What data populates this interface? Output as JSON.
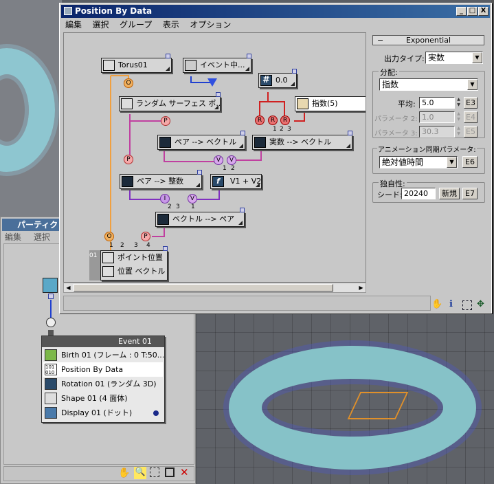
{
  "dialog": {
    "title": "Position By Data",
    "menu": [
      "編集",
      "選択",
      "グループ",
      "表示",
      "オプション"
    ],
    "window_buttons": [
      "_",
      "□",
      "X"
    ]
  },
  "nodes": {
    "torus": "Torus01",
    "event": "イベント中...",
    "float": "0.0",
    "exp": "指数(5)",
    "rsurf": "ランダム サーフェス ポ...",
    "pair_vec": "ペア --> ベクトル",
    "real_vec": "実数 --> ベクトル",
    "pair_int": "ペア --> 整数",
    "func": "V1 + V2",
    "vec_pair": "ベクトル --> ペア",
    "out_a": "ポイント位置",
    "out_b": "位置 ベクトル",
    "out_num": "01"
  },
  "pins": {
    "o": "O",
    "p": "P",
    "r": "R",
    "v": "V",
    "i": "I",
    "n1": "1",
    "n2": "2",
    "n3": "3",
    "n4": "4"
  },
  "panel": {
    "header": "Exponential",
    "collapse": "−",
    "output_type_label": "出力タイプ:",
    "output_type_value": "実数",
    "distribution_group": "分配:",
    "distribution_value": "指数",
    "mean_label": "平均:",
    "mean_value": "5.0",
    "e3": "E3",
    "param2_label": "パラメータ 2:",
    "param2_value": "1.0",
    "e4": "E4",
    "param3_label": "パラメータ 3:",
    "param3_value": "30.3",
    "e5": "E5",
    "anim_group": "アニメーション同期パラメータ:",
    "anim_value": "絶対値時間",
    "e6": "E6",
    "unique_group": "独自性:",
    "seed_label": "シード:",
    "seed_value": "20240",
    "new_button": "新規",
    "e7": "E7"
  },
  "status_icons": [
    "hand-icon",
    "info-icon",
    "zoom-region-icon",
    "pan-icon"
  ],
  "particle_view": {
    "title": "パーティクル",
    "menu": [
      "編集",
      "選択"
    ],
    "event_title": "Event 01",
    "operators": [
      "Birth 01 (フレーム : 0 T:50...",
      "Position By Data",
      "Rotation 01 (ランダム 3D)",
      "Shape 01 (4 面体)",
      "Display 01 (ドット)"
    ],
    "toolbar_icons": [
      "hand-icon",
      "zoom-icon",
      "zoom-region-icon",
      "zoom-extents-icon",
      "no-zoom-icon"
    ]
  },
  "colors": {
    "title_bar": "#0a246a",
    "orange_wire": "#f0a040",
    "red_wire": "#d02020",
    "magenta_wire": "#c040a0",
    "purple_wire": "#8030c0",
    "blue_wire": "#2040d0"
  }
}
